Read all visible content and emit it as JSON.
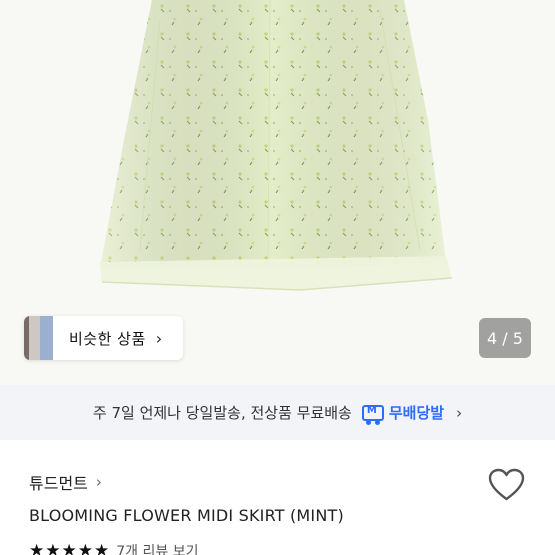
{
  "product": {
    "brand": "튜드먼트",
    "title": "BLOOMING FLOWER MIDI SKIRT (MINT)",
    "image_alt": "mint floral midi skirt",
    "image_counter": "4 / 5"
  },
  "similar": {
    "label": "비슷한 상품"
  },
  "shipping": {
    "text": "주 7일 언제나 당일발송, 전상품 무료배송",
    "badge_label": "무배당발",
    "badge_icon": "M"
  },
  "rating": {
    "stars": 5,
    "review_text": "7개 리뷰 보기"
  },
  "colors": {
    "accent": "#2f6bff",
    "skirt": "#e3ecc7",
    "banner_bg": "#f3f4f7"
  },
  "icons": {
    "similar_chevron": "›",
    "brand_chevron": "›",
    "badge_chevron": "›",
    "star": "★",
    "heart": "heart-outline-icon"
  }
}
